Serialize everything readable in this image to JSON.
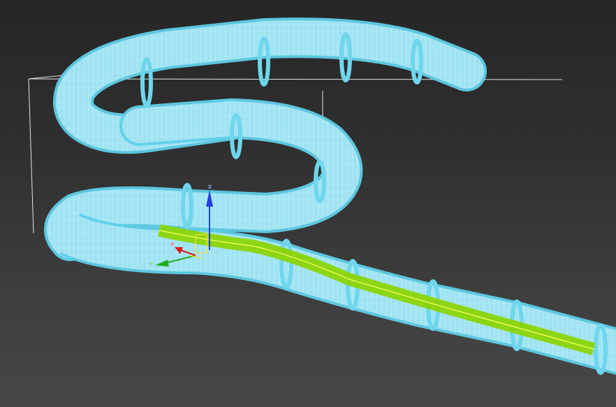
{
  "viewport": {
    "background_top": "#262626",
    "background_bottom": "#474747"
  },
  "colors": {
    "tube_fill": "#8fdcef",
    "tube_stroke": "#5fcfe8",
    "tube_mesh": "#eafcff",
    "selection_green": "#8ad400",
    "path_spline": "#ffff66",
    "bounding_box": "#e6e6e6",
    "axis_x": "#e01b1b",
    "axis_y": "#1fae1f",
    "axis_z": "#2040e0"
  },
  "gizmo": {
    "z_label": "Z",
    "y_label": "Y",
    "x_label": "X"
  },
  "icons": [
    "transform-gizmo-icon",
    "axis-z-arrow-icon",
    "axis-y-arrow-icon",
    "axis-x-arrow-icon"
  ]
}
